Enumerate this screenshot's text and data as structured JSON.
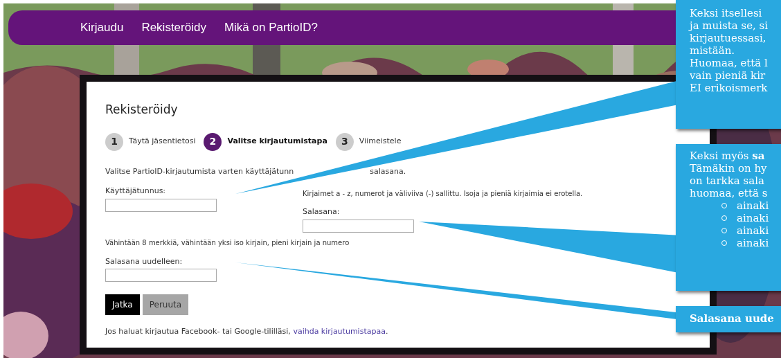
{
  "nav": [
    {
      "label": "Kirjaudu"
    },
    {
      "label": "Rekisteröidy"
    },
    {
      "label": "Mikä on PartioID?"
    }
  ],
  "card": {
    "title": "Rekisteröidy",
    "steps": [
      {
        "number": "1",
        "label": "Täytä jäsentietosi",
        "selected": false
      },
      {
        "number": "2",
        "label": "Valitse kirjautumistapa",
        "selected": true
      },
      {
        "number": "3",
        "label": "Viimeistele",
        "selected": false
      }
    ],
    "instruction": [
      "Valitse PartioID-kirjautumista varten käyttäjätunn",
      "salasana."
    ],
    "username": {
      "label": "Käyttäjätunnus:",
      "hint": "Kirjaimet a - z, numerot ja väliviiva (-) sallittu. Isoja ja pieniä kirjaimia ei erotella."
    },
    "password": {
      "label": "Salasana:",
      "hint": "Vähintään 8 merkkiä, vähintään yksi iso kirjain, pieni kirjain ja numero"
    },
    "password_repeat": {
      "label": "Salasana uudelleen:"
    },
    "buttons": [
      {
        "label": "Jatka",
        "kind": "primary"
      },
      {
        "label": "Peruuta",
        "kind": "secondary"
      }
    ],
    "footer": {
      "text": "Jos haluat kirjautua Facebook- tai Google-tililläsi, ",
      "link": "vaihda kirjautumistapaa",
      "end": "."
    }
  },
  "callouts": [
    {
      "bold": false,
      "lines": [
        "Keksi itsellesi",
        "ja muista se, si",
        "kirjautuessasi,",
        "mistään.",
        "Huomaa, että l",
        "vain pieniä kir",
        "EI erikoismerk"
      ]
    },
    {
      "bold": false,
      "lines": [
        "Keksi myös **sa**",
        "Tämäkin on hy",
        "on tarkka sala",
        "huomaa, että s"
      ],
      "bullets": [
        "ainaki",
        "ainaki",
        "ainaki",
        "ainaki"
      ]
    },
    {
      "bold": true,
      "lines": [
        "Salasana uude"
      ]
    }
  ]
}
